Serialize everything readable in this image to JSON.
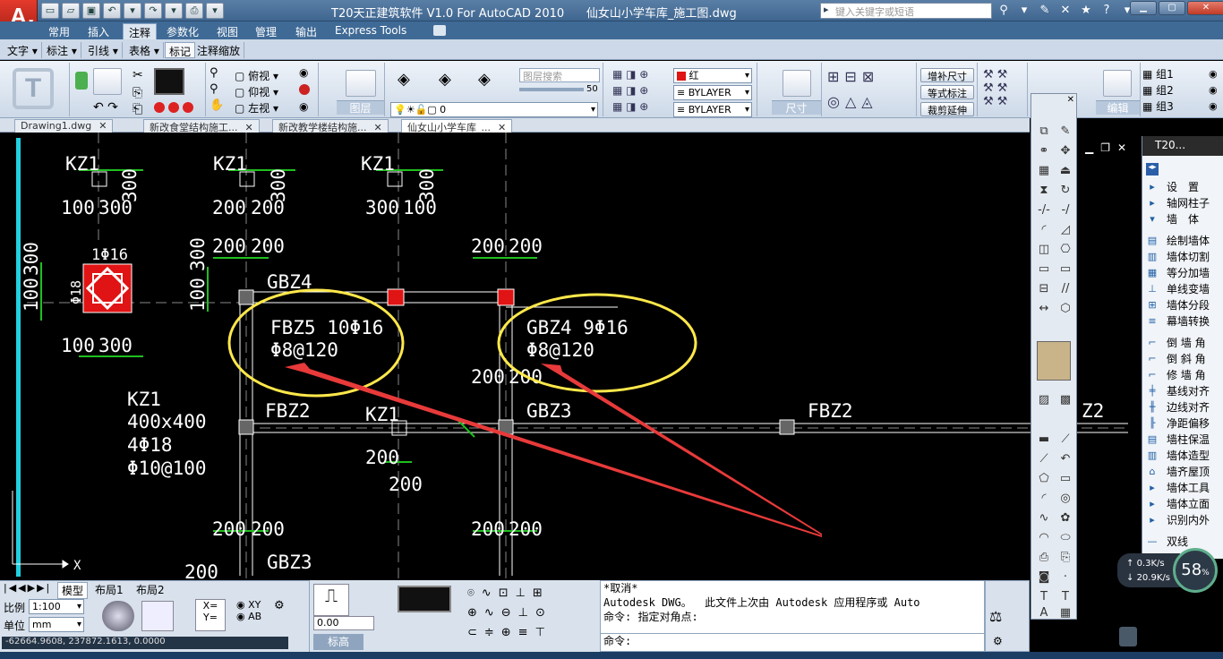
{
  "window": {
    "title": "T20天正建筑软件 V1.0 For AutoCAD 2010      仙女山小学车库_施工图.dwg",
    "logo_text": "A",
    "search_placeholder": "键入关键字或短语"
  },
  "ribbon_tabs": [
    "常用",
    "插入",
    "注释",
    "参数化",
    "视图",
    "管理",
    "输出",
    "Express Tools"
  ],
  "active_ribbon_tab": "注释",
  "sub_tabs": [
    "文字",
    "标注",
    "引线",
    "表格",
    "标记",
    "注释缩放"
  ],
  "ribbon": {
    "view_buttons": [
      "俯视",
      "仰视",
      "左视"
    ],
    "layer_panel_label": "图层",
    "layer_search_placeholder": "图层搜索",
    "layer_slider_value": "50",
    "layer_current": "0",
    "color_value": "红",
    "linetype_value": "BYLAYER",
    "lineweight_value": "BYLAYER",
    "dim_panel_label": "尺寸",
    "dim_buttons": [
      "增补尺寸",
      "等式标注",
      "裁剪延伸"
    ],
    "edit_label": "编辑",
    "groups": [
      "组1",
      "组2",
      "组3"
    ]
  },
  "doc_tabs": [
    {
      "label": "Drawing1.dwg",
      "active": false
    },
    {
      "label": "新改食堂结构施工...",
      "active": false
    },
    {
      "label": "新改教学楼结构施...",
      "active": false
    },
    {
      "label": "仙女山小学车库_...",
      "active": true
    }
  ],
  "drawing": {
    "column_labels": [
      "KZ1",
      "KZ1",
      "KZ1",
      "KZ1",
      "KZ1"
    ],
    "dim_labels_top": [
      "100",
      "300",
      "200",
      "200",
      "300",
      "100",
      "300",
      "300",
      "300"
    ],
    "row_dims": [
      "200",
      "200",
      "200",
      "200",
      "200",
      "200",
      "200",
      "200",
      "200",
      "200"
    ],
    "kz1_detail": [
      "400x400",
      "4Φ18",
      "Φ10@100"
    ],
    "kz1_left_dims": [
      "100",
      "300",
      "100",
      "300",
      "Φ16",
      "Φ18"
    ],
    "gbz_labels": [
      "GBZ4",
      "GBZ3",
      "GBZ3"
    ],
    "fbz_labels": [
      "FBZ2",
      "FBZ2",
      "Z2"
    ],
    "annotation_1": [
      "FBZ5 10Φ16",
      "Φ8@120"
    ],
    "annotation_2": [
      "GBZ4 9Φ16",
      "Φ8@120"
    ],
    "misc_dims": [
      "200",
      "200",
      "200"
    ],
    "axis_x_label": "X",
    "colors": {
      "green": "#1fbf1f",
      "white": "#ffffff",
      "yellow": "#ffe84a",
      "red": "#e01414",
      "cyan": "#22d0e0",
      "arrow": "#e83a3a"
    }
  },
  "t20_menu": {
    "title": "T20...",
    "items": [
      "设　置",
      "轴网柱子",
      "墙　体",
      "绘制墙体",
      "墙体切割",
      "等分加墙",
      "单线变墙",
      "墙体分段",
      "幕墙转换",
      "倒 墙 角",
      "倒 斜 角",
      "修 墙 角",
      "基线对齐",
      "边线对齐",
      "净距偏移",
      "墙柱保温",
      "墙体造型",
      "墙齐屋顶",
      "墙体工具",
      "墙体立面",
      "识别内外",
      "双线"
    ]
  },
  "layout_tabs": [
    "模型",
    "布局1",
    "布局2"
  ],
  "status": {
    "scale_label": "比例",
    "scale_value": "1:100",
    "unit_label": "单位",
    "unit_value": "mm",
    "coords": "-62664.9608, 237872.1613, 0.0000",
    "elevation_value": "0.00",
    "elevation_label": "标高"
  },
  "command": {
    "lines": [
      "*取消*",
      "Autodesk DWG。  此文件上次由 Autodesk 应用程序或 Auto",
      "命令: 指定对角点:"
    ],
    "prompt": "命令:"
  },
  "net": {
    "up": "0.3K/s",
    "down": "20.9K/s",
    "percent": "58"
  }
}
